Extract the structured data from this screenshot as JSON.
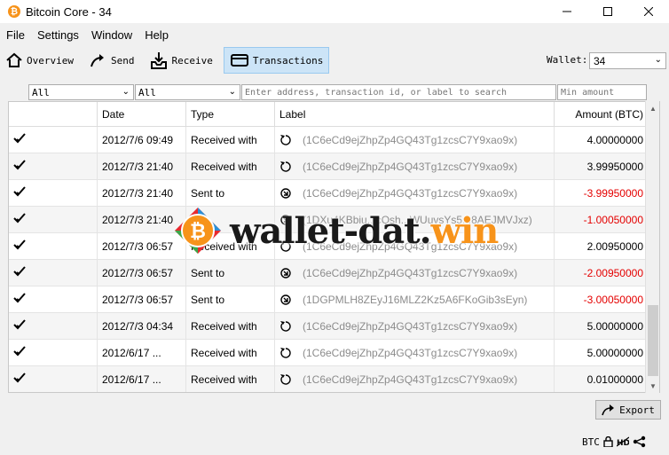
{
  "window": {
    "title": "Bitcoin Core - 34",
    "app_icon": "bitcoin-icon",
    "controls": [
      "minimize-icon",
      "maximize-icon",
      "close-icon"
    ]
  },
  "menu": [
    "File",
    "Settings",
    "Window",
    "Help"
  ],
  "toolbar": {
    "buttons": [
      {
        "label": "Overview",
        "icon": "home-icon"
      },
      {
        "label": "Send",
        "icon": "send-arrow-icon"
      },
      {
        "label": "Receive",
        "icon": "receive-tray-icon"
      },
      {
        "label": "Transactions",
        "icon": "wallet-card-icon",
        "active": true
      }
    ],
    "wallet_label": "Wallet:",
    "wallet_value": "34"
  },
  "filters": {
    "date_value": "All",
    "type_value": "All",
    "search_placeholder": "Enter address, transaction id, or label to search",
    "min_amount_placeholder": "Min amount"
  },
  "table": {
    "columns": [
      "",
      "Date",
      "Type",
      "Label",
      "Amount (BTC)"
    ],
    "rows": [
      {
        "date": "2012/7/6 09:49",
        "type": "Received with",
        "label": "(1C6eCd9ejZhpZp4GQ43Tg1zcsC7Y9xao9x)",
        "amount": "4.00000000",
        "negative": false
      },
      {
        "date": "2012/7/3 21:40",
        "type": "Received with",
        "label": "(1C6eCd9ejZhpZp4GQ43Tg1zcsC7Y9xao9x)",
        "amount": "3.99950000",
        "negative": false
      },
      {
        "date": "2012/7/3 21:40",
        "type": "Sent to",
        "label": "(1C6eCd9ejZhpZp4GQ43Tg1zcsC7Y9xao9x)",
        "amount": "-3.99950000",
        "negative": true
      },
      {
        "date": "2012/7/3 21:40",
        "type": "",
        "label": "(1DXu4KBbiu...cQsh...WUuvsYs5...8AEJMVJxz)",
        "amount": "-1.00050000",
        "negative": true
      },
      {
        "date": "2012/7/3 06:57",
        "type": "Received with",
        "label": "(1C6eCd9ejZhpZp4GQ43Tg1zcsC7Y9xao9x)",
        "amount": "2.00950000",
        "negative": false
      },
      {
        "date": "2012/7/3 06:57",
        "type": "Sent to",
        "label": "(1C6eCd9ejZhpZp4GQ43Tg1zcsC7Y9xao9x)",
        "amount": "-2.00950000",
        "negative": true
      },
      {
        "date": "2012/7/3 06:57",
        "type": "Sent to",
        "label": "(1DGPMLH8ZEyJ16MLZ2Kz5A6FKoGib3sEyn)",
        "amount": "-3.00050000",
        "negative": true
      },
      {
        "date": "2012/7/3 04:34",
        "type": "Received with",
        "label": "(1C6eCd9ejZhpZp4GQ43Tg1zcsC7Y9xao9x)",
        "amount": "5.00000000",
        "negative": false
      },
      {
        "date": "2012/6/17 ...",
        "type": "Received with",
        "label": "(1C6eCd9ejZhpZp4GQ43Tg1zcsC7Y9xao9x)",
        "amount": "5.00000000",
        "negative": false
      },
      {
        "date": "2012/6/17 ...",
        "type": "Received with",
        "label": "(1C6eCd9ejZhpZp4GQ43Tg1zcsC7Y9xao9x)",
        "amount": "0.01000000",
        "negative": false
      }
    ]
  },
  "export_label": "Export",
  "status": {
    "unit": "BTC",
    "icons": [
      "lock-icon",
      "hd-disabled-icon",
      "network-icon"
    ]
  },
  "watermark": {
    "prefix": "wallet-dat.",
    "suffix": "win"
  },
  "colors": {
    "accent": "#f7931a",
    "negative": "#e40000",
    "active_tab": "#cce4f7"
  }
}
